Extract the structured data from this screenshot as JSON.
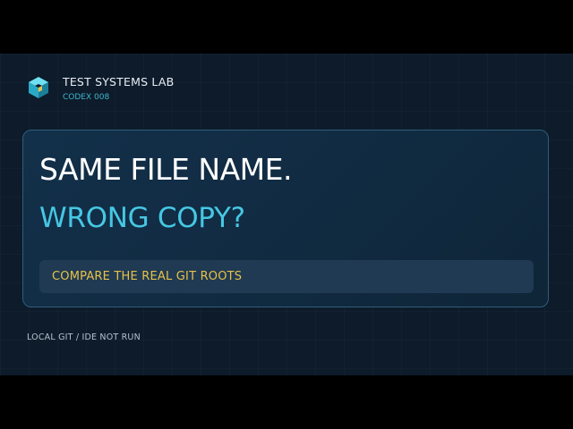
{
  "brand": {
    "title": "TEST SYSTEMS LAB",
    "subtitle": "CODEX 008",
    "logo_icon": "cube-icon"
  },
  "card": {
    "headline_primary": "SAME FILE NAME.",
    "headline_secondary": "WRONG COPY?",
    "callout": "COMPARE THE REAL GIT ROOTS"
  },
  "footer": {
    "note": "LOCAL GIT / IDE NOT RUN"
  },
  "colors": {
    "background": "#0d1b2a",
    "accent_cyan": "#46c7e3",
    "accent_yellow": "#e8c14a",
    "card_border": "#2f5d78"
  }
}
